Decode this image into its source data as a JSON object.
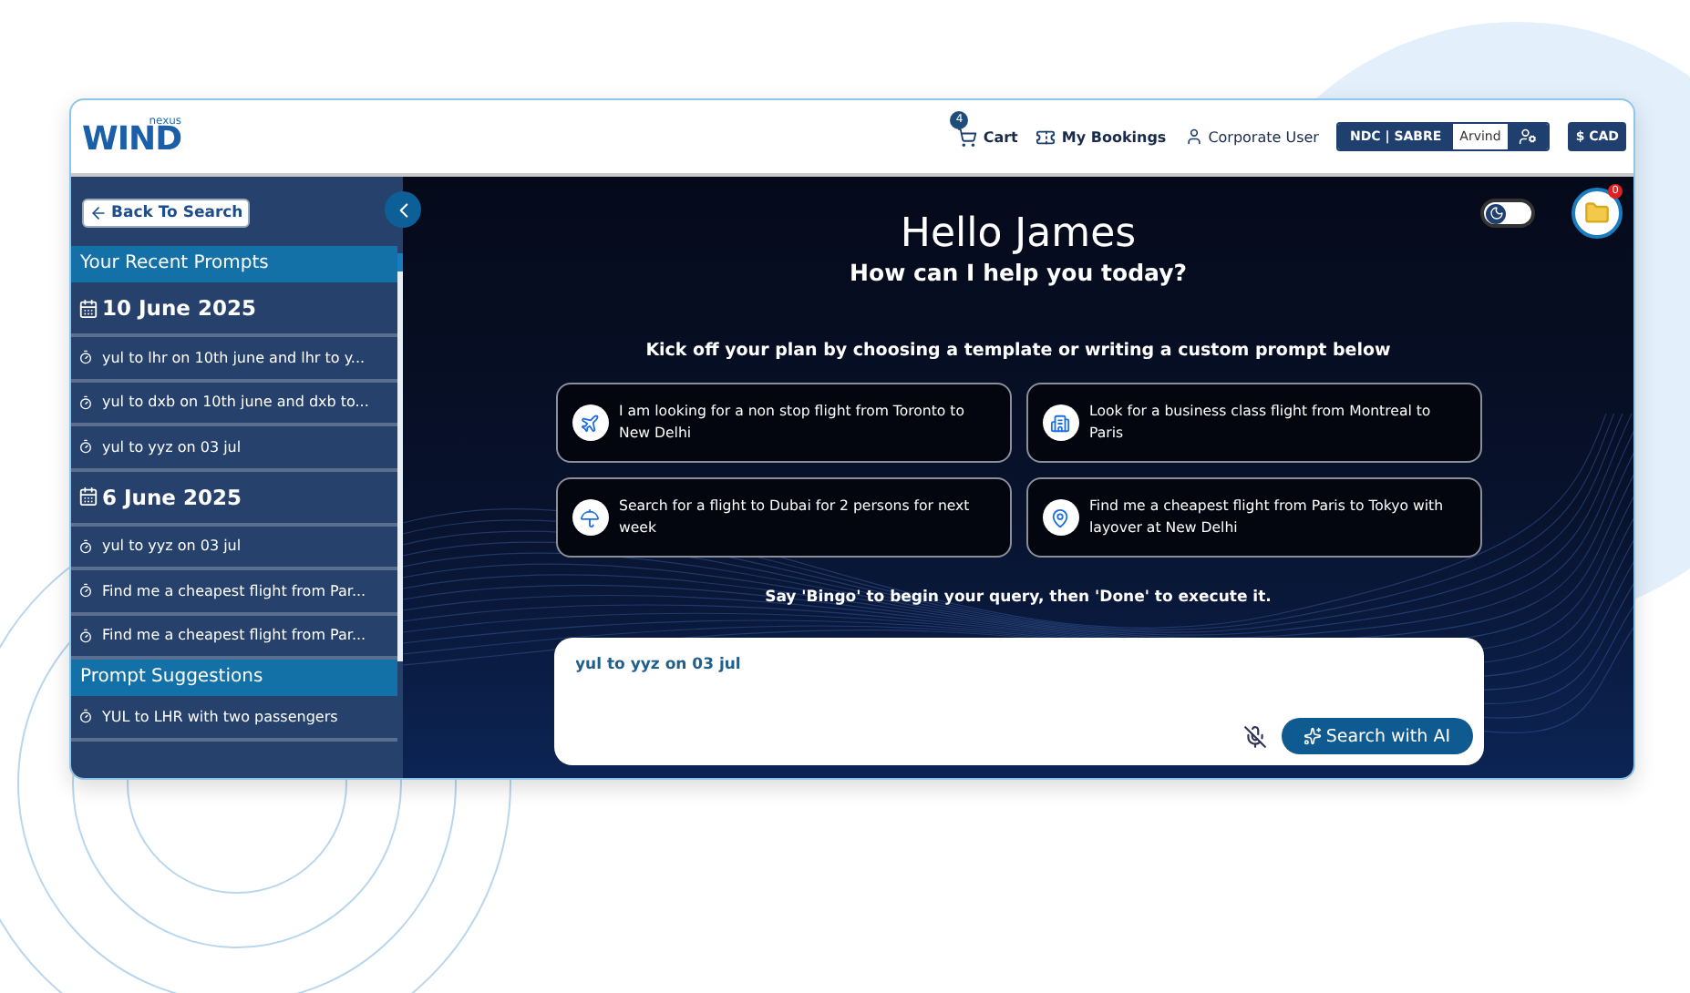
{
  "logo": {
    "small": "nexus",
    "big": "WIND"
  },
  "header": {
    "cart": {
      "label": "Cart",
      "count": "4"
    },
    "bookings": "My Bookings",
    "user": "Corporate User",
    "gds": "NDC | SABRE",
    "agent": "Arvind",
    "currency": "$ CAD"
  },
  "sidebar": {
    "back": "Back To Search",
    "recent_title": "Your Recent Prompts",
    "groups": [
      {
        "date": "10 June 2025",
        "items": [
          "yul to lhr on 10th june and lhr to y...",
          "yul to dxb on 10th june and dxb to...",
          "yul to yyz on 03 jul"
        ]
      },
      {
        "date": "6 June 2025",
        "items": [
          "yul to yyz on 03 jul",
          "Find me a cheapest flight from Par...",
          "Find me a cheapest flight from Par..."
        ]
      }
    ],
    "suggestions_title": "Prompt Suggestions",
    "suggestions": [
      "YUL to LHR with two passengers"
    ]
  },
  "main": {
    "light_mode": false,
    "notifications": "0",
    "greeting": "Hello James",
    "subtitle": "How can I help you today?",
    "intro": "Kick off your plan by choosing a template or writing a custom prompt below",
    "templates": [
      "I am looking for a non stop flight from Toronto to New Delhi",
      "Look for a business class flight from Montreal to Paris",
      "Search for a flight to Dubai for 2 persons for next week",
      "Find me a cheapest flight from Paris to Tokyo with layover at New Delhi"
    ],
    "hint": "Say 'Bingo' to begin your query, then 'Done' to execute it.",
    "prompt": {
      "value": "yul to yyz on 03 jul",
      "mic_muted": true,
      "button": "Search with AI"
    }
  }
}
